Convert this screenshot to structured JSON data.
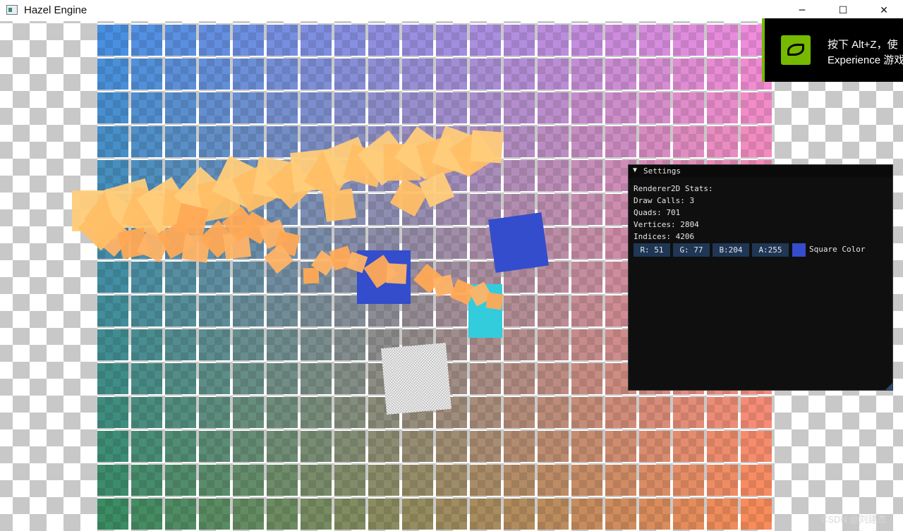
{
  "window": {
    "title": "Hazel Engine",
    "min_glyph": "─",
    "max_glyph": "☐",
    "close_glyph": "✕"
  },
  "grid": {
    "cols": 20,
    "rows": 15
  },
  "quads": {
    "blue_square_color": "#334dcc",
    "cyan_square_color": "#33ccdd",
    "particle_colors": [
      "#ffcc7a",
      "#ffbf66",
      "#ffb366",
      "#ffa955"
    ]
  },
  "nvidia_overlay": {
    "line1": "按下 Alt+Z，使",
    "line2": "Experience 游戏"
  },
  "settings_panel": {
    "title": "Settings",
    "collapse_glyph": "▼",
    "stats_heading": "Renderer2D Stats:",
    "draw_calls": "Draw Calls: 3",
    "quads": "Quads: 701",
    "vertices": "Vertices: 2804",
    "indices": "Indices: 4206",
    "color_r": "R: 51",
    "color_g": "G: 77",
    "color_b": "B:204",
    "color_a": "A:255",
    "color_label": "Square Color",
    "color_hex": "#334dcc"
  },
  "watermark": "CSDN @刘建杰"
}
